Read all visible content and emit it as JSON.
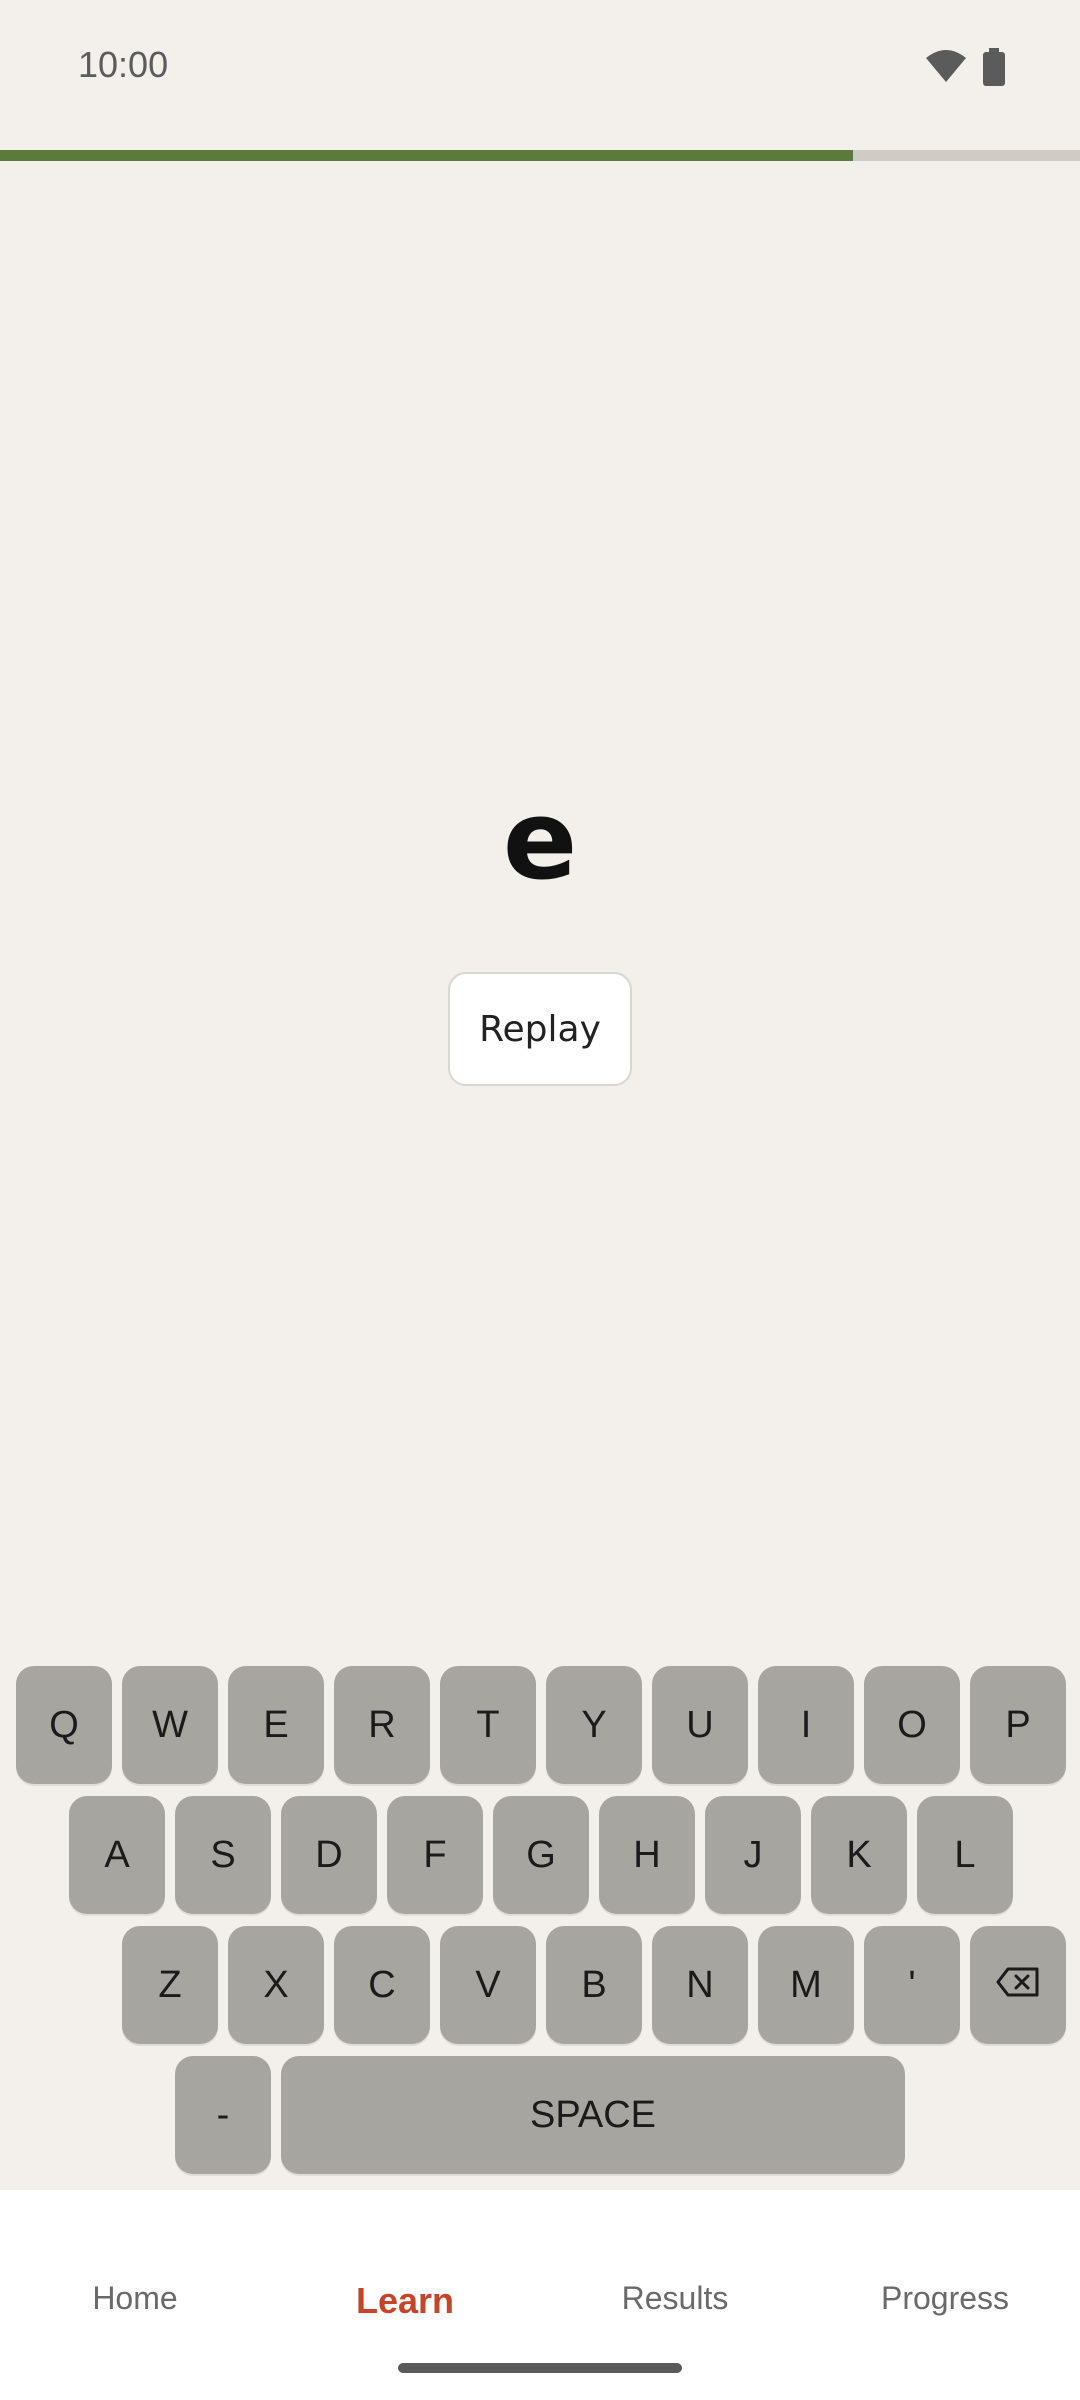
{
  "status_bar": {
    "time": "10:00",
    "icons": [
      "wifi-icon",
      "battery-icon"
    ]
  },
  "lesson_progress": {
    "fraction": 0.79,
    "fill_color": "#5b7a3b",
    "track_color": "#d0cbc5"
  },
  "prompt": {
    "letter": "e",
    "replay_label": "Replay"
  },
  "keyboard": {
    "rows": [
      [
        "Q",
        "W",
        "E",
        "R",
        "T",
        "Y",
        "U",
        "I",
        "O",
        "P"
      ],
      [
        "A",
        "S",
        "D",
        "F",
        "G",
        "H",
        "J",
        "K",
        "L"
      ],
      [
        "Z",
        "X",
        "C",
        "V",
        "B",
        "N",
        "M",
        "'"
      ],
      [
        "-",
        "SPACE"
      ]
    ],
    "backspace_icon": "backspace-icon",
    "key_color": "#a7a59f"
  },
  "bottom_nav": {
    "items": [
      {
        "label": "Home",
        "active": false
      },
      {
        "label": "Learn",
        "active": true
      },
      {
        "label": "Results",
        "active": false
      },
      {
        "label": "Progress",
        "active": false
      }
    ],
    "active_color": "#c64528"
  }
}
